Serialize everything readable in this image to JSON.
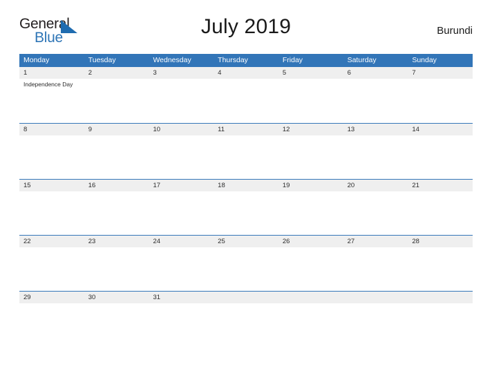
{
  "brand": {
    "name_part1": "General",
    "name_part2": "Blue",
    "triangle_icon": "triangle-icon",
    "blue": "#2e75b6"
  },
  "header": {
    "title": "July 2019",
    "country": "Burundi"
  },
  "colors": {
    "header_blue": "#3275b8",
    "daynum_band": "#efefef",
    "cell_background": "#ffffff",
    "text": "#2b2b2b"
  },
  "calendar": {
    "weekdays": [
      "Monday",
      "Tuesday",
      "Wednesday",
      "Thursday",
      "Friday",
      "Saturday",
      "Sunday"
    ],
    "weeks": [
      {
        "days": [
          {
            "num": "1",
            "events": [
              "Independence Day"
            ]
          },
          {
            "num": "2",
            "events": []
          },
          {
            "num": "3",
            "events": []
          },
          {
            "num": "4",
            "events": []
          },
          {
            "num": "5",
            "events": []
          },
          {
            "num": "6",
            "events": []
          },
          {
            "num": "7",
            "events": []
          }
        ]
      },
      {
        "days": [
          {
            "num": "8",
            "events": []
          },
          {
            "num": "9",
            "events": []
          },
          {
            "num": "10",
            "events": []
          },
          {
            "num": "11",
            "events": []
          },
          {
            "num": "12",
            "events": []
          },
          {
            "num": "13",
            "events": []
          },
          {
            "num": "14",
            "events": []
          }
        ]
      },
      {
        "days": [
          {
            "num": "15",
            "events": []
          },
          {
            "num": "16",
            "events": []
          },
          {
            "num": "17",
            "events": []
          },
          {
            "num": "18",
            "events": []
          },
          {
            "num": "19",
            "events": []
          },
          {
            "num": "20",
            "events": []
          },
          {
            "num": "21",
            "events": []
          }
        ]
      },
      {
        "days": [
          {
            "num": "22",
            "events": []
          },
          {
            "num": "23",
            "events": []
          },
          {
            "num": "24",
            "events": []
          },
          {
            "num": "25",
            "events": []
          },
          {
            "num": "26",
            "events": []
          },
          {
            "num": "27",
            "events": []
          },
          {
            "num": "28",
            "events": []
          }
        ]
      },
      {
        "days": [
          {
            "num": "29",
            "events": []
          },
          {
            "num": "30",
            "events": []
          },
          {
            "num": "31",
            "events": []
          },
          {
            "num": "",
            "events": []
          },
          {
            "num": "",
            "events": []
          },
          {
            "num": "",
            "events": []
          },
          {
            "num": "",
            "events": []
          }
        ]
      }
    ]
  }
}
